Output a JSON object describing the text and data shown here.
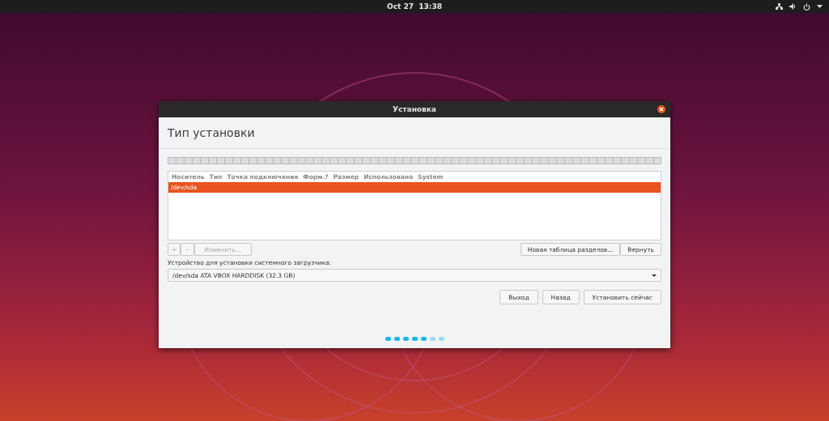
{
  "top_bar": {
    "date": "Oct 27",
    "time": "13:38"
  },
  "window": {
    "title": "Установка"
  },
  "heading": "Тип установки",
  "partition_table": {
    "columns": [
      "Носитель",
      "Тип",
      "Точка подключения",
      "Форм.?",
      "Размер",
      "Использовано",
      "System"
    ],
    "rows": [
      {
        "device": "/dev/sda",
        "selected": true
      }
    ]
  },
  "edit_buttons": [
    {
      "label": "+",
      "disabled": true
    },
    {
      "label": "−",
      "disabled": true
    },
    {
      "label": "Изменить...",
      "disabled": true
    }
  ],
  "table_buttons": [
    "Новая таблица разделов...",
    "Вернуть"
  ],
  "bootloader": {
    "label": "Устройство для установки системного загрузчика:",
    "value": "/dev/sda ATA VBOX HARDDISK (32.3 GB)"
  },
  "footer_buttons": [
    "Выход",
    "Назад",
    "Установить сейчас"
  ],
  "progress_steps": [
    {
      "done": true
    },
    {
      "done": true
    },
    {
      "done": true
    },
    {
      "done": true
    },
    {
      "done": true
    },
    {
      "done": false
    },
    {
      "done": false
    }
  ]
}
